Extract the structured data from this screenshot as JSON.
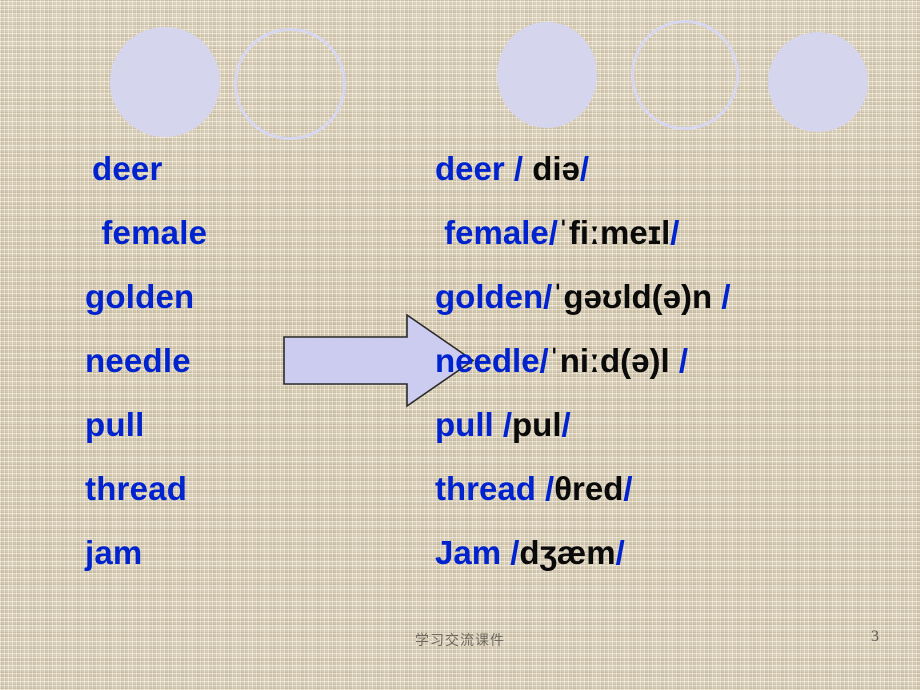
{
  "slide": {
    "page_number": "3",
    "footer_note": "学习交流课件",
    "background_color": "#d5c8ae",
    "word_color": "#0023cf",
    "ipa_color": "#0a0a0a",
    "accent_color": "#d6d5ee"
  },
  "decorations": {
    "circles": [
      {
        "name": "circle-filled-1",
        "style": "filled"
      },
      {
        "name": "circle-outline-1",
        "style": "outline"
      },
      {
        "name": "circle-filled-2",
        "style": "filled"
      },
      {
        "name": "circle-outline-2",
        "style": "outline"
      },
      {
        "name": "circle-filled-3",
        "style": "filled"
      }
    ],
    "arrow": {
      "name": "right-arrow",
      "direction": "right",
      "fill": "#ccccf0",
      "stroke": "#2b2b2b"
    }
  },
  "vocabulary": {
    "rows": [
      {
        "word": "deer",
        "pronunciation_word": "deer",
        "open_slash": " / ",
        "ipa": "diə",
        "close_slash": "/"
      },
      {
        "word": " female",
        "pronunciation_word": " female",
        "open_slash": "/",
        "ipa": "ˈfiːmeɪl",
        "close_slash": "/"
      },
      {
        "word": "golden",
        "pronunciation_word": "golden",
        "open_slash": "/",
        "ipa": "ˈgəʊld(ə)n ",
        "close_slash": "/"
      },
      {
        "word": "needle",
        "pronunciation_word": "needle",
        "open_slash": "/",
        "ipa": "ˈniːd(ə)l ",
        "close_slash": "/"
      },
      {
        "word": "pull",
        "pronunciation_word": "pull",
        "open_slash": " /",
        "ipa": "pul",
        "close_slash": "/"
      },
      {
        "word": "thread",
        "pronunciation_word": "thread",
        "open_slash": " /",
        "ipa": "θred",
        "close_slash": "/"
      },
      {
        "word": "jam",
        "pronunciation_word": "Jam",
        "open_slash": " /",
        "ipa": "dʒæm",
        "close_slash": "/"
      }
    ]
  }
}
